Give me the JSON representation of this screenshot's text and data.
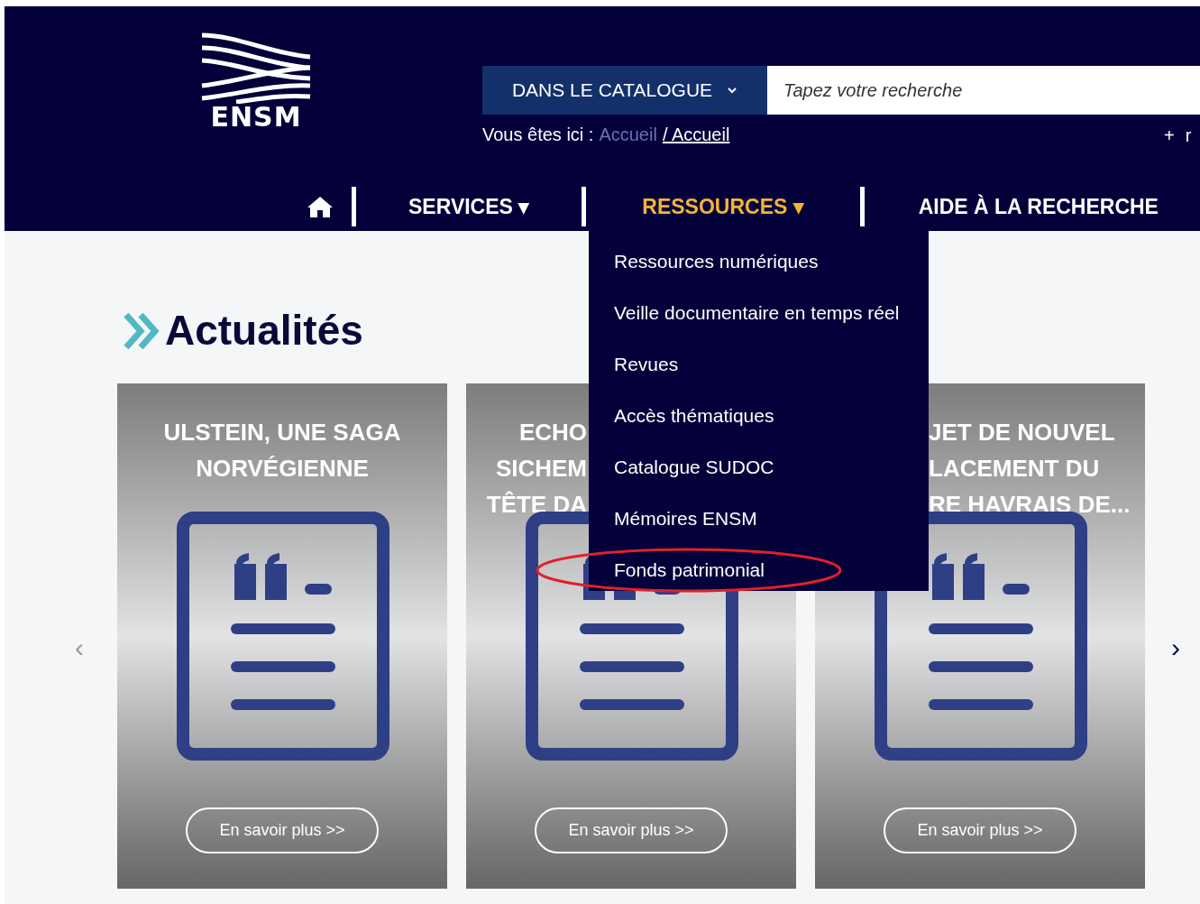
{
  "logo": {
    "text": "ENSM"
  },
  "search": {
    "scope": "DANS LE CATALOGUE",
    "placeholder": "Tapez votre recherche"
  },
  "breadcrumb": {
    "label": "Vous êtes ici :",
    "items": [
      {
        "text": "Accueil",
        "current": false
      },
      {
        "text": "/ Accueil",
        "current": true
      }
    ]
  },
  "more_link": {
    "icon": "+",
    "text": "r"
  },
  "nav": [
    {
      "kind": "home",
      "selected": false
    },
    {
      "kind": "menu",
      "label": "SERVICES",
      "caret": "▾",
      "selected": false
    },
    {
      "kind": "menu",
      "label": "RESSOURCES",
      "caret": "▾",
      "selected": true
    },
    {
      "kind": "menu",
      "label": "AIDE À LA RECHERCHE",
      "selected": false
    }
  ],
  "dropdown": [
    {
      "label": "Ressources numériques",
      "circled": false
    },
    {
      "label": "Veille documentaire en temps réel",
      "circled": false
    },
    {
      "label": "Revues",
      "circled": false
    },
    {
      "label": "Accès thématiques",
      "circled": false
    },
    {
      "label": "Catalogue SUDOC",
      "circled": false
    },
    {
      "label": "Mémoires ENSM",
      "circled": false
    },
    {
      "label": "Fonds patrimonial",
      "circled": true
    }
  ],
  "section": {
    "title": "Actualités"
  },
  "carousel": {
    "prev": "‹",
    "next": "›",
    "cards": [
      {
        "title_lines": [
          "ULSTEIN, UNE SAGA",
          "NORVÉGIENNE"
        ],
        "button": "En savoir plus >>"
      },
      {
        "title_lines": [
          "ECHO",
          "SICHEM",
          "TÊTE DA"
        ],
        "button": "En savoir plus >>"
      },
      {
        "title_lines": [
          "JET DE NOUVEL",
          "LACEMENT DU",
          "RE HAVRAIS DE..."
        ],
        "button": "En savoir plus >>"
      }
    ]
  }
}
